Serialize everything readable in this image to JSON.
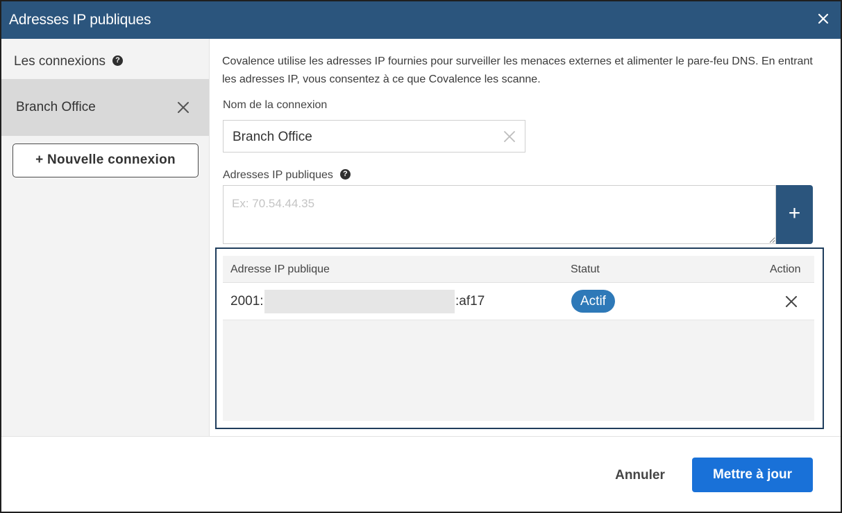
{
  "dialog": {
    "title": "Adresses IP publiques",
    "close_icon": "close-icon"
  },
  "sidebar": {
    "heading": "Les connexions",
    "help_icon": "help-circle-icon",
    "help_glyph": "?",
    "items": [
      {
        "label": "Branch Office",
        "selected": true,
        "remove_icon": "close-icon"
      }
    ],
    "new_button_label": "+ Nouvelle connexion"
  },
  "form": {
    "description": "Covalence utilise les adresses IP fournies pour surveiller les menaces externes et alimenter le pare-feu DNS. En entrant les adresses IP, vous consentez à ce que Covalence les scanne.",
    "name_label": "Nom de la connexion",
    "name_value": "Branch Office",
    "ip_label": "Adresses IP publiques",
    "ip_placeholder": "Ex: 70.54.44.35",
    "add_button_label": "+"
  },
  "table": {
    "columns": [
      "Adresse IP publique",
      "Statut",
      "Action"
    ],
    "rows": [
      {
        "ip_prefix": "2001:",
        "ip_suffix": ":af17",
        "ip_redacted": true,
        "status": "Actif",
        "action_icon": "close-icon"
      }
    ]
  },
  "footer": {
    "cancel_label": "Annuler",
    "update_label": "Mettre à jour"
  },
  "colors": {
    "titlebar": "#2b557d",
    "primary_button": "#1971d8",
    "status_active": "#2e79b8",
    "highlight_frame": "#1f3d5c",
    "sidebar_bg": "#f3f3f3",
    "selected_item_bg": "#d9d9d9"
  }
}
